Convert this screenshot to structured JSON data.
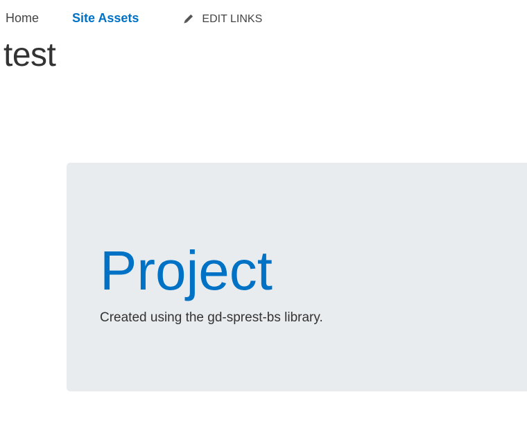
{
  "topnav": {
    "items": [
      {
        "label": "Home"
      },
      {
        "label": "Site Assets"
      }
    ],
    "edit_links_label": "EDIT LINKS",
    "edit_icon": "pencil-icon"
  },
  "site": {
    "title": "test"
  },
  "jumbotron": {
    "title": "Project",
    "lead": "Created using the gd-sprest-bs library."
  },
  "colors": {
    "accent": "#0072c6",
    "jumbotron_bg": "#e9ecef",
    "text": "#333333"
  }
}
